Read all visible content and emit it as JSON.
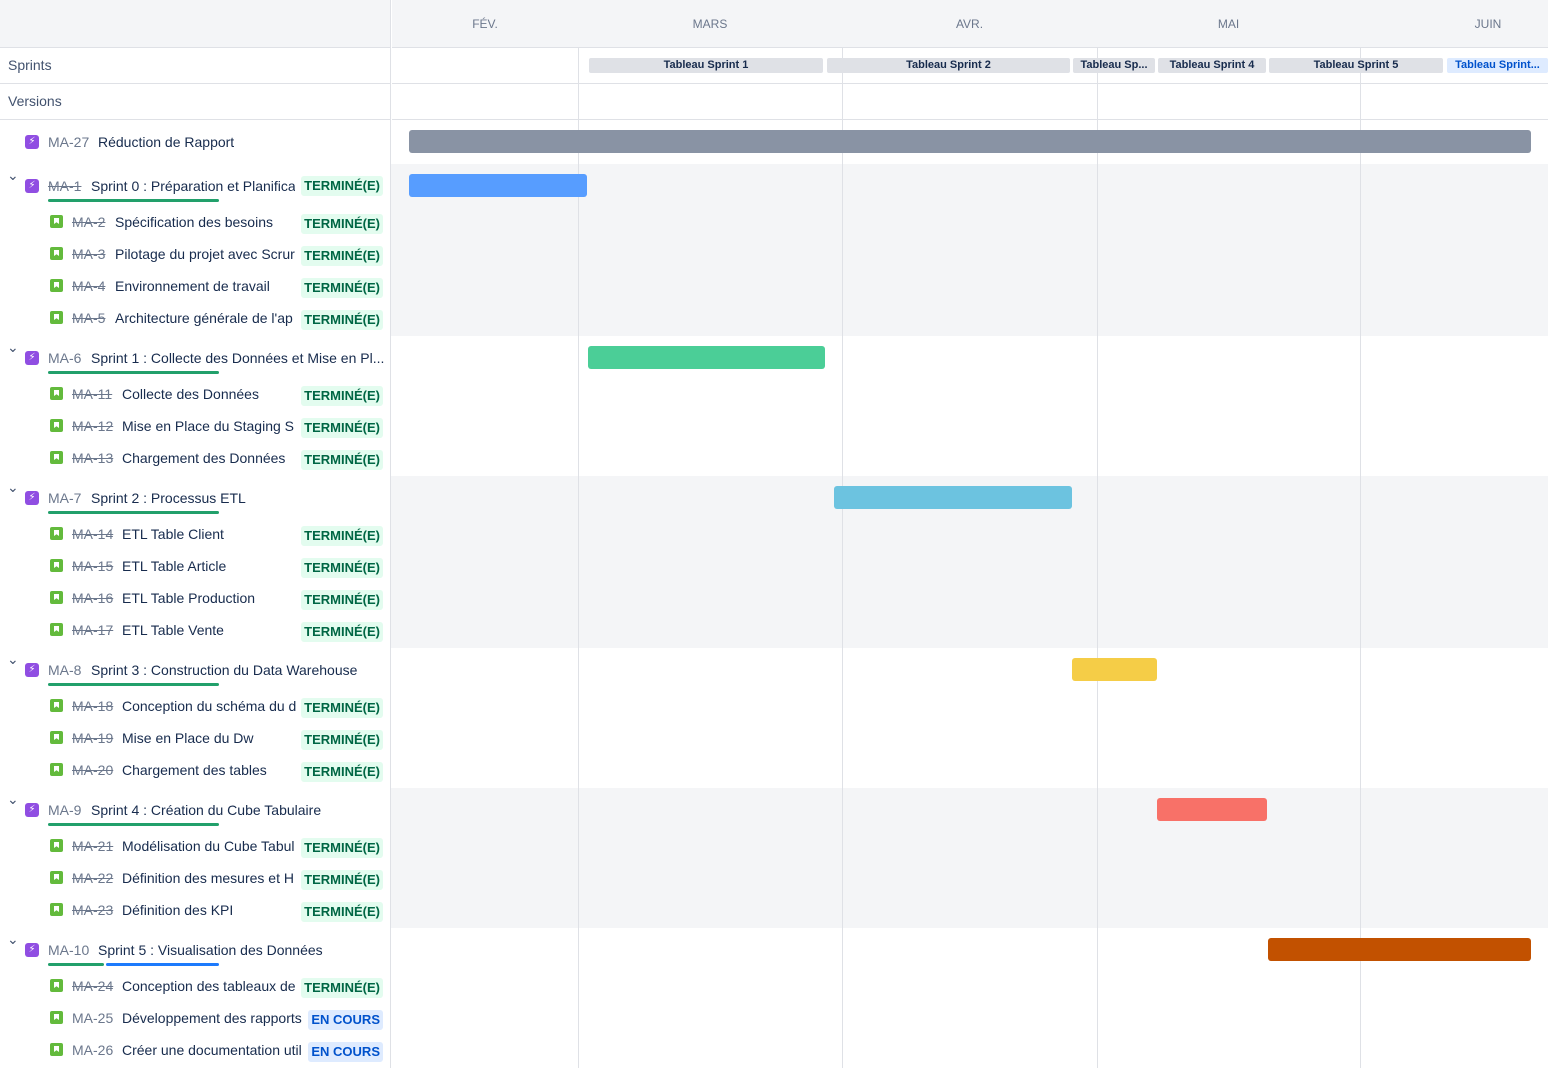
{
  "months": [
    "FÉV.",
    "MARS",
    "AVR.",
    "MAI",
    "JUIN"
  ],
  "meta_rows": {
    "sprints": "Sprints",
    "versions": "Versions"
  },
  "sprints": [
    {
      "label": "Tableau Sprint 1",
      "active": false
    },
    {
      "label": "Tableau Sprint 2",
      "active": false
    },
    {
      "label": "Tableau Sp...",
      "active": false
    },
    {
      "label": "Tableau Sprint 4",
      "active": false
    },
    {
      "label": "Tableau Sprint 5",
      "active": false
    },
    {
      "label": "Tableau Sprint...",
      "active": true
    }
  ],
  "top_epic": {
    "key": "MA-27",
    "title": "Réduction de Rapport",
    "bar_color": "#8993a4"
  },
  "epics": [
    {
      "key": "MA-1",
      "key_done": true,
      "title": "Sprint 0 : Préparation et Planifica",
      "status": "TERMINÉ(E)",
      "bar_color": "#579dff",
      "progress_done": 1.0,
      "progress_inprog": 0.0,
      "children": [
        {
          "key": "MA-2",
          "title": "Spécification des besoins",
          "status": "TERMINÉ(E)",
          "done": true
        },
        {
          "key": "MA-3",
          "title": "Pilotage du projet avec Scrur",
          "status": "TERMINÉ(E)",
          "done": true
        },
        {
          "key": "MA-4",
          "title": "Environnement de travail",
          "status": "TERMINÉ(E)",
          "done": true
        },
        {
          "key": "MA-5",
          "title": "Architecture générale de l'ap",
          "status": "TERMINÉ(E)",
          "done": true
        }
      ]
    },
    {
      "key": "MA-6",
      "key_done": false,
      "title": "Sprint 1 : Collecte des Données et Mise en Pl...",
      "status": "",
      "bar_color": "#4bce97",
      "progress_done": 1.0,
      "progress_inprog": 0.0,
      "children": [
        {
          "key": "MA-11",
          "title": "Collecte des Données",
          "status": "TERMINÉ(E)",
          "done": true
        },
        {
          "key": "MA-12",
          "title": "Mise en Place du Staging S",
          "status": "TERMINÉ(E)",
          "done": true
        },
        {
          "key": "MA-13",
          "title": "Chargement des Données",
          "status": "TERMINÉ(E)",
          "done": true
        }
      ]
    },
    {
      "key": "MA-7",
      "key_done": false,
      "title": "Sprint 2 : Processus ETL",
      "status": "",
      "bar_color": "#6cc3e0",
      "progress_done": 1.0,
      "progress_inprog": 0.0,
      "children": [
        {
          "key": "MA-14",
          "title": "ETL Table Client",
          "status": "TERMINÉ(E)",
          "done": true
        },
        {
          "key": "MA-15",
          "title": "ETL Table Article",
          "status": "TERMINÉ(E)",
          "done": true
        },
        {
          "key": "MA-16",
          "title": "ETL Table Production",
          "status": "TERMINÉ(E)",
          "done": true
        },
        {
          "key": "MA-17",
          "title": "ETL Table Vente",
          "status": "TERMINÉ(E)",
          "done": true
        }
      ]
    },
    {
      "key": "MA-8",
      "key_done": false,
      "title": "Sprint 3 : Construction du Data Warehouse",
      "status": "",
      "bar_color": "#f5cd47",
      "progress_done": 1.0,
      "progress_inprog": 0.0,
      "children": [
        {
          "key": "MA-18",
          "title": "Conception du schéma du d",
          "status": "TERMINÉ(E)",
          "done": true
        },
        {
          "key": "MA-19",
          "title": "Mise en Place du Dw",
          "status": "TERMINÉ(E)",
          "done": true
        },
        {
          "key": "MA-20",
          "title": "Chargement des tables",
          "status": "TERMINÉ(E)",
          "done": true
        }
      ]
    },
    {
      "key": "MA-9",
      "key_done": false,
      "title": "Sprint 4 : Création du Cube Tabulaire",
      "status": "",
      "bar_color": "#f87168",
      "progress_done": 1.0,
      "progress_inprog": 0.0,
      "children": [
        {
          "key": "MA-21",
          "title": "Modélisation du Cube Tabul",
          "status": "TERMINÉ(E)",
          "done": true
        },
        {
          "key": "MA-22",
          "title": "Définition des mesures et H",
          "status": "TERMINÉ(E)",
          "done": true
        },
        {
          "key": "MA-23",
          "title": "Définition des KPI",
          "status": "TERMINÉ(E)",
          "done": true
        }
      ]
    },
    {
      "key": "MA-10",
      "key_done": false,
      "title": "Sprint 5 : Visualisation des Données",
      "status": "",
      "bar_color": "#c25100",
      "progress_done": 0.33,
      "progress_inprog": 0.67,
      "children": [
        {
          "key": "MA-24",
          "title": "Conception des tableaux de",
          "status": "TERMINÉ(E)",
          "done": true
        },
        {
          "key": "MA-25",
          "title": "Développement des rapports",
          "status": "EN COURS",
          "done": false
        },
        {
          "key": "MA-26",
          "title": "Créer une documentation util",
          "status": "EN COURS",
          "done": false
        }
      ]
    }
  ]
}
